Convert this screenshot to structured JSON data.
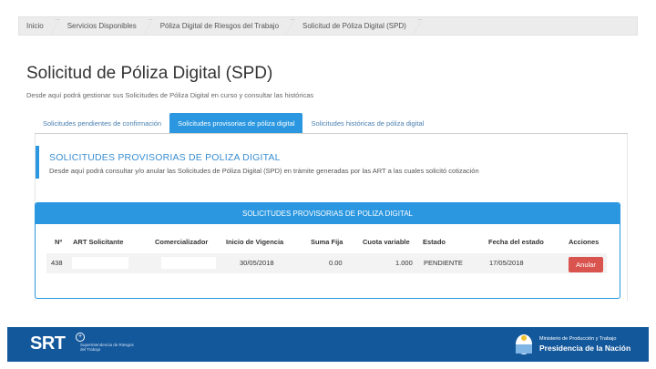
{
  "breadcrumb": [
    "Inicio",
    "Servicios Disponibles",
    "Póliza Digital de Riesgos del Trabajo",
    "Solicitud de Póliza Digital (SPD)"
  ],
  "page": {
    "title": "Solicitud de Póliza Digital (SPD)",
    "subtitle": "Desde aquí podrá gestionar sus Solicitudes de Póliza Digital en curso y consultar las históricas"
  },
  "tabs": [
    {
      "label": "Solicitudes pendientes de confirmación",
      "active": false
    },
    {
      "label": "Solicitudes provisorias de póliza digital",
      "active": true
    },
    {
      "label": "Solicitudes históricas de póliza digital",
      "active": false
    }
  ],
  "callout": {
    "title": "SOLICITUDES PROVISORIAS DE POLIZA DIGITAL",
    "text": "Desde aquí podrá consultar y/o anular las Solicitudes de Póliza Digital (SPD) en trámite generadas por las ART a las cuales solicitó cotización"
  },
  "table": {
    "title": "SOLICITUDES PROVISORIAS DE POLIZA DIGITAL",
    "columns": [
      "Nº",
      "ART Solicitante",
      "Comercializador",
      "Inicio de Vigencia",
      "Suma Fija",
      "Cuota variable",
      "Estado",
      "Fecha del estado",
      "Acciones"
    ],
    "rows": [
      {
        "num": "438",
        "art": "",
        "comercializador": "",
        "inicio": "30/05/2018",
        "suma_fija": "0.00",
        "cuota_variable": "1.000",
        "estado": "PENDIENTE",
        "fecha_estado": "17/05/2018",
        "accion": "Anular"
      }
    ]
  },
  "footer": {
    "brand": "SRT",
    "brand_sub": "Superintendencia de Riesgos del Trabajo",
    "gov_line1": "Ministerio de Producción y Trabajo",
    "gov_line2": "Presidencia de la Nación"
  },
  "colors": {
    "accent": "#2a97e0",
    "danger": "#d9534f",
    "footer": "#14589c"
  }
}
